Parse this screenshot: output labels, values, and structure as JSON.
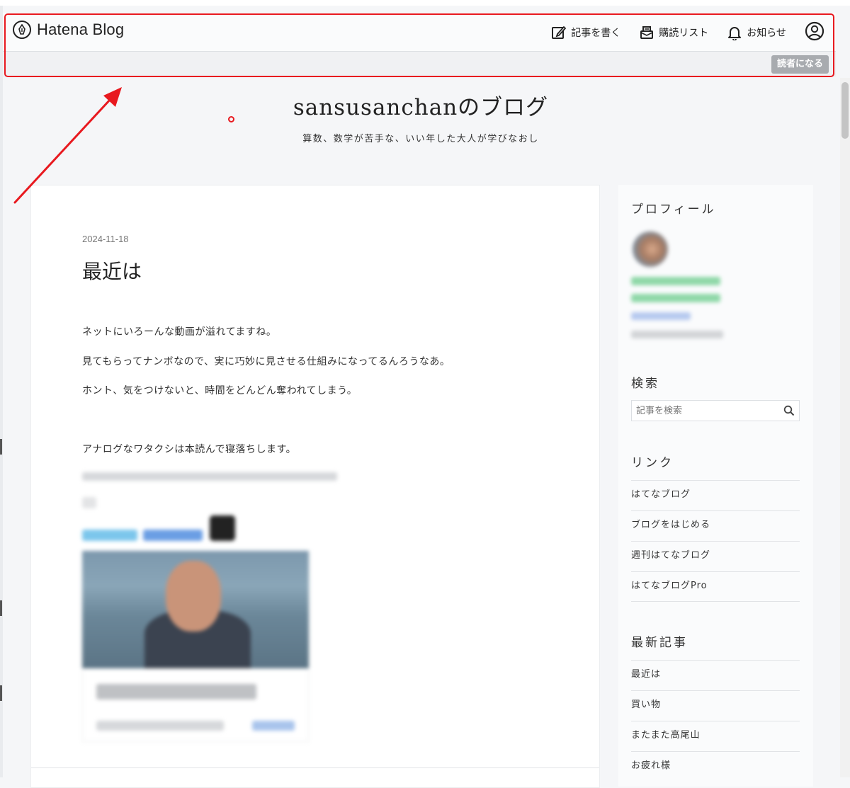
{
  "header": {
    "logo_text": "Hatena Blog",
    "nav": [
      {
        "label": "記事を書く",
        "icon": "edit-icon"
      },
      {
        "label": "購読リスト",
        "icon": "reading-list-icon"
      },
      {
        "label": "お知らせ",
        "icon": "bell-icon"
      }
    ],
    "user_icon": "user-icon",
    "reader_button": "読者になる"
  },
  "blog": {
    "title": "sansusanchanのブログ",
    "description": "算数、数学が苦手な、いい年した大人が学びなおし"
  },
  "article": {
    "date": "2024-11-18",
    "title": "最近は",
    "paragraphs": [
      "ネットにいろーんな動画が溢れてますね。",
      "見てもらってナンボなので、実に巧妙に見させる仕組みになってるんろうなあ。",
      "ホント、気をつけないと、時間をどんどん奪われてしまう。",
      "アナログなワタクシは本読んで寝落ちします。"
    ]
  },
  "sidebar": {
    "profile_heading": "プロフィール",
    "search_heading": "検索",
    "search_placeholder": "記事を検索",
    "links_heading": "リンク",
    "links": [
      "はてなブログ",
      "ブログをはじめる",
      "週刊はてなブログ",
      "はてなブログPro"
    ],
    "recent_heading": "最新記事",
    "recent": [
      "最近は",
      "買い物",
      "またまた高尾山",
      "お疲れ様"
    ]
  },
  "annotation_color": "#e8191f"
}
